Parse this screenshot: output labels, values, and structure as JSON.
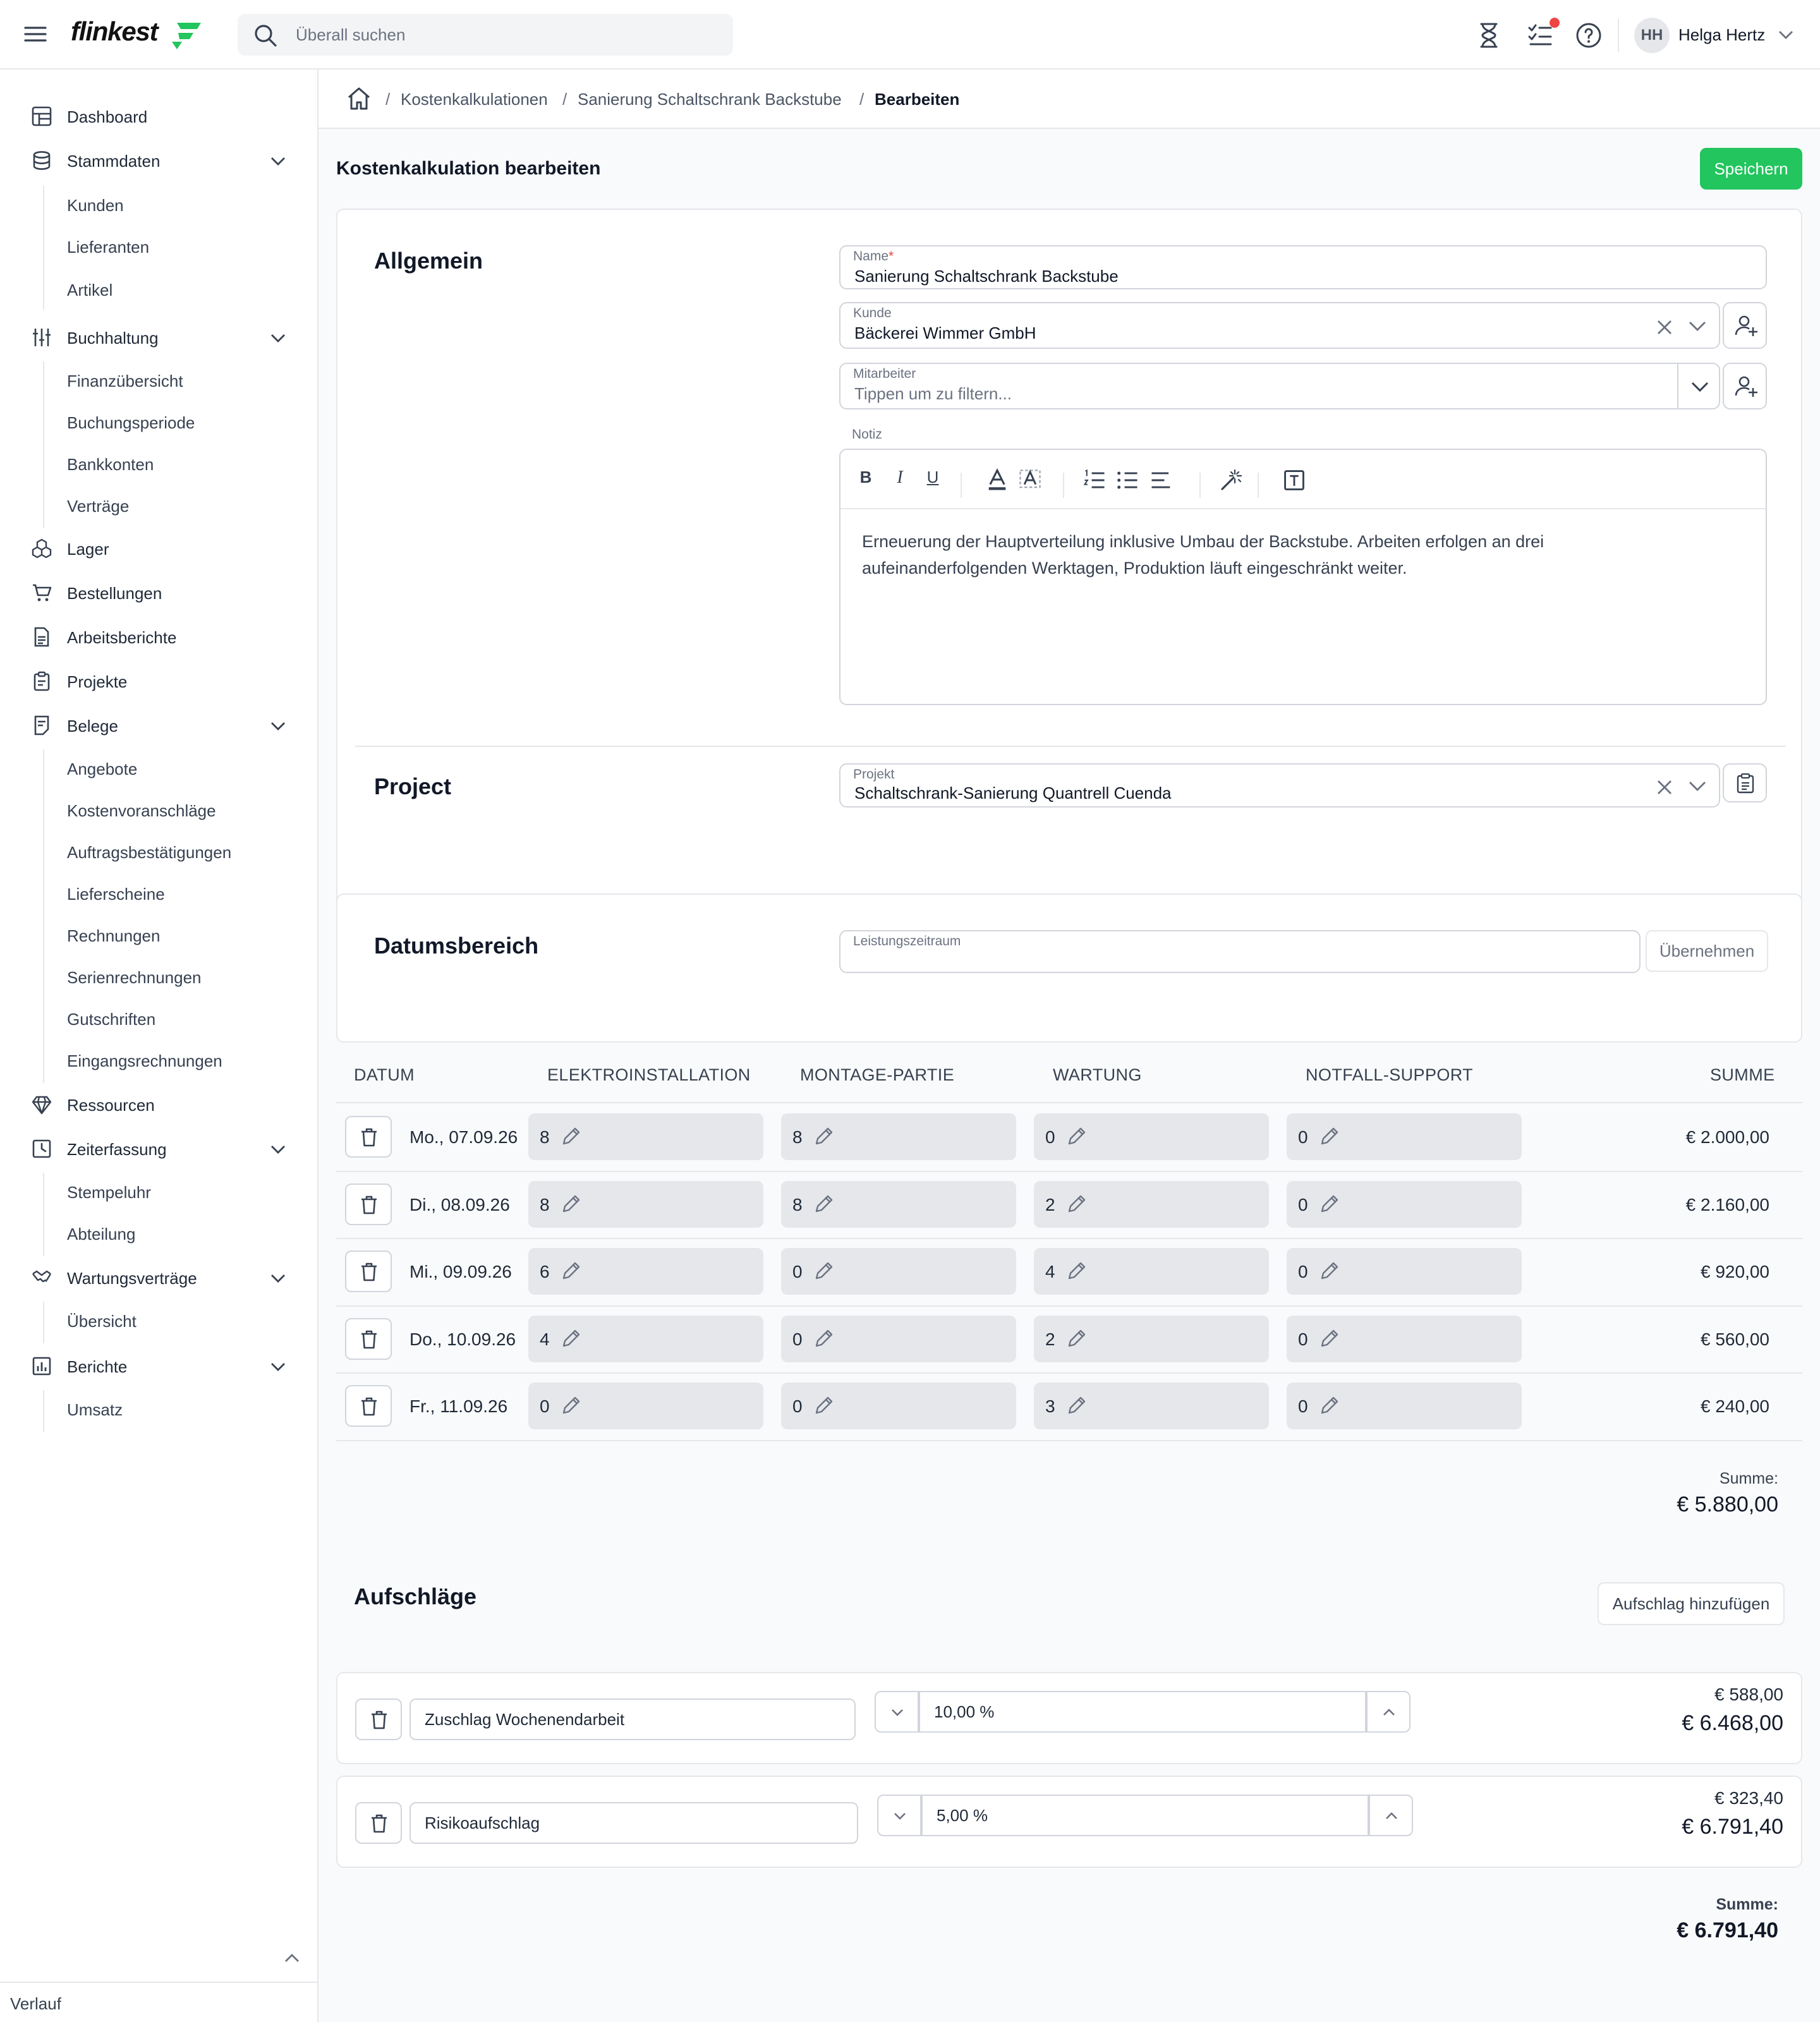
{
  "app": {
    "logo": "flinkest"
  },
  "search": {
    "placeholder": "Überall suchen"
  },
  "user": {
    "initials": "HH",
    "name": "Helga Hertz"
  },
  "sidebar": {
    "items": [
      {
        "label": "Dashboard",
        "icon": "dashboard-icon"
      },
      {
        "label": "Stammdaten",
        "icon": "database-icon",
        "children": [
          "Kunden",
          "Lieferanten",
          "Artikel"
        ]
      },
      {
        "label": "Buchhaltung",
        "icon": "sliders-icon",
        "children": [
          "Finanzübersicht",
          "Buchungsperiode",
          "Bankkonten",
          "Verträge"
        ]
      },
      {
        "label": "Lager",
        "icon": "boxes-icon"
      },
      {
        "label": "Bestellungen",
        "icon": "cart-icon"
      },
      {
        "label": "Arbeitsberichte",
        "icon": "report-icon"
      },
      {
        "label": "Projekte",
        "icon": "clipboard-icon"
      },
      {
        "label": "Belege",
        "icon": "receipt-icon",
        "children": [
          "Angebote",
          "Kostenvoranschläge",
          "Auftragsbestätigungen",
          "Lieferscheine",
          "Rechnungen",
          "Serienrechnungen",
          "Gutschriften",
          "Eingangsrechnungen"
        ]
      },
      {
        "label": "Ressourcen",
        "icon": "diamond-icon"
      },
      {
        "label": "Zeiterfassung",
        "icon": "timesheet-icon",
        "children": [
          "Stempeluhr",
          "Abteilung"
        ]
      },
      {
        "label": "Wartungsverträge",
        "icon": "handshake-icon",
        "children": [
          "Übersicht"
        ]
      },
      {
        "label": "Berichte",
        "icon": "chart-icon",
        "children": [
          "Umsatz"
        ]
      }
    ],
    "footer": "Verlauf"
  },
  "breadcrumb": {
    "items": [
      "Kostenkalkulationen",
      "Sanierung Schaltschrank Backstube"
    ],
    "current": "Bearbeiten"
  },
  "page": {
    "title": "Kostenkalkulation bearbeiten",
    "save_label": "Speichern"
  },
  "allgemein": {
    "title": "Allgemein",
    "name_label": "Name",
    "name_required": "*",
    "name_value": "Sanierung Schaltschrank Backstube",
    "kunde_label": "Kunde",
    "kunde_value": "Bäckerei Wimmer GmbH",
    "mitarbeiter_label": "Mitarbeiter",
    "mitarbeiter_placeholder": "Tippen um zu filtern...",
    "notiz_label": "Notiz",
    "notiz_text": "Erneuerung der Hauptverteilung inklusive Umbau der Backstube. Arbeiten erfolgen an drei aufeinanderfolgenden Werktagen, Produktion läuft eingeschränkt weiter.",
    "toolbar": {
      "bold": "B",
      "italic": "I",
      "underline": "U"
    }
  },
  "project": {
    "title": "Project",
    "label": "Projekt",
    "value": "Schaltschrank-Sanierung Quantrell Cuenda"
  },
  "datumsbereich": {
    "title": "Datumsbereich",
    "label": "Leistungszeitraum",
    "apply_label": "Übernehmen"
  },
  "table": {
    "headers": [
      "DATUM",
      "ELEKTROINSTALLATION",
      "MONTAGE-PARTIE",
      "WARTUNG",
      "NOTFALL-SUPPORT",
      "SUMME"
    ],
    "rows": [
      {
        "date": "Mo., 07.09.26",
        "values": [
          "8",
          "8",
          "0",
          "0"
        ],
        "sum": "€ 2.000,00"
      },
      {
        "date": "Di., 08.09.26",
        "values": [
          "8",
          "8",
          "2",
          "0"
        ],
        "sum": "€ 2.160,00"
      },
      {
        "date": "Mi., 09.09.26",
        "values": [
          "6",
          "0",
          "4",
          "0"
        ],
        "sum": "€ 920,00"
      },
      {
        "date": "Do., 10.09.26",
        "values": [
          "4",
          "0",
          "2",
          "0"
        ],
        "sum": "€ 560,00"
      },
      {
        "date": "Fr., 11.09.26",
        "values": [
          "0",
          "0",
          "3",
          "0"
        ],
        "sum": "€ 240,00"
      }
    ],
    "total_label": "Summe:",
    "total_value": "€ 5.880,00"
  },
  "aufschlaege": {
    "title": "Aufschläge",
    "add_label": "Aufschlag hinzufügen",
    "items": [
      {
        "name": "Zuschlag Wochenendarbeit",
        "percent": "10,00 %",
        "amount": "€ 588,00",
        "running_total": "€ 6.468,00"
      },
      {
        "name": "Risikoaufschlag",
        "percent": "5,00 %",
        "amount": "€ 323,40",
        "running_total": "€ 6.791,40"
      }
    ],
    "total_label": "Summe:",
    "total_value": "€ 6.791,40"
  },
  "colors": {
    "accent": "#22c55e",
    "required": "#ef4444"
  }
}
